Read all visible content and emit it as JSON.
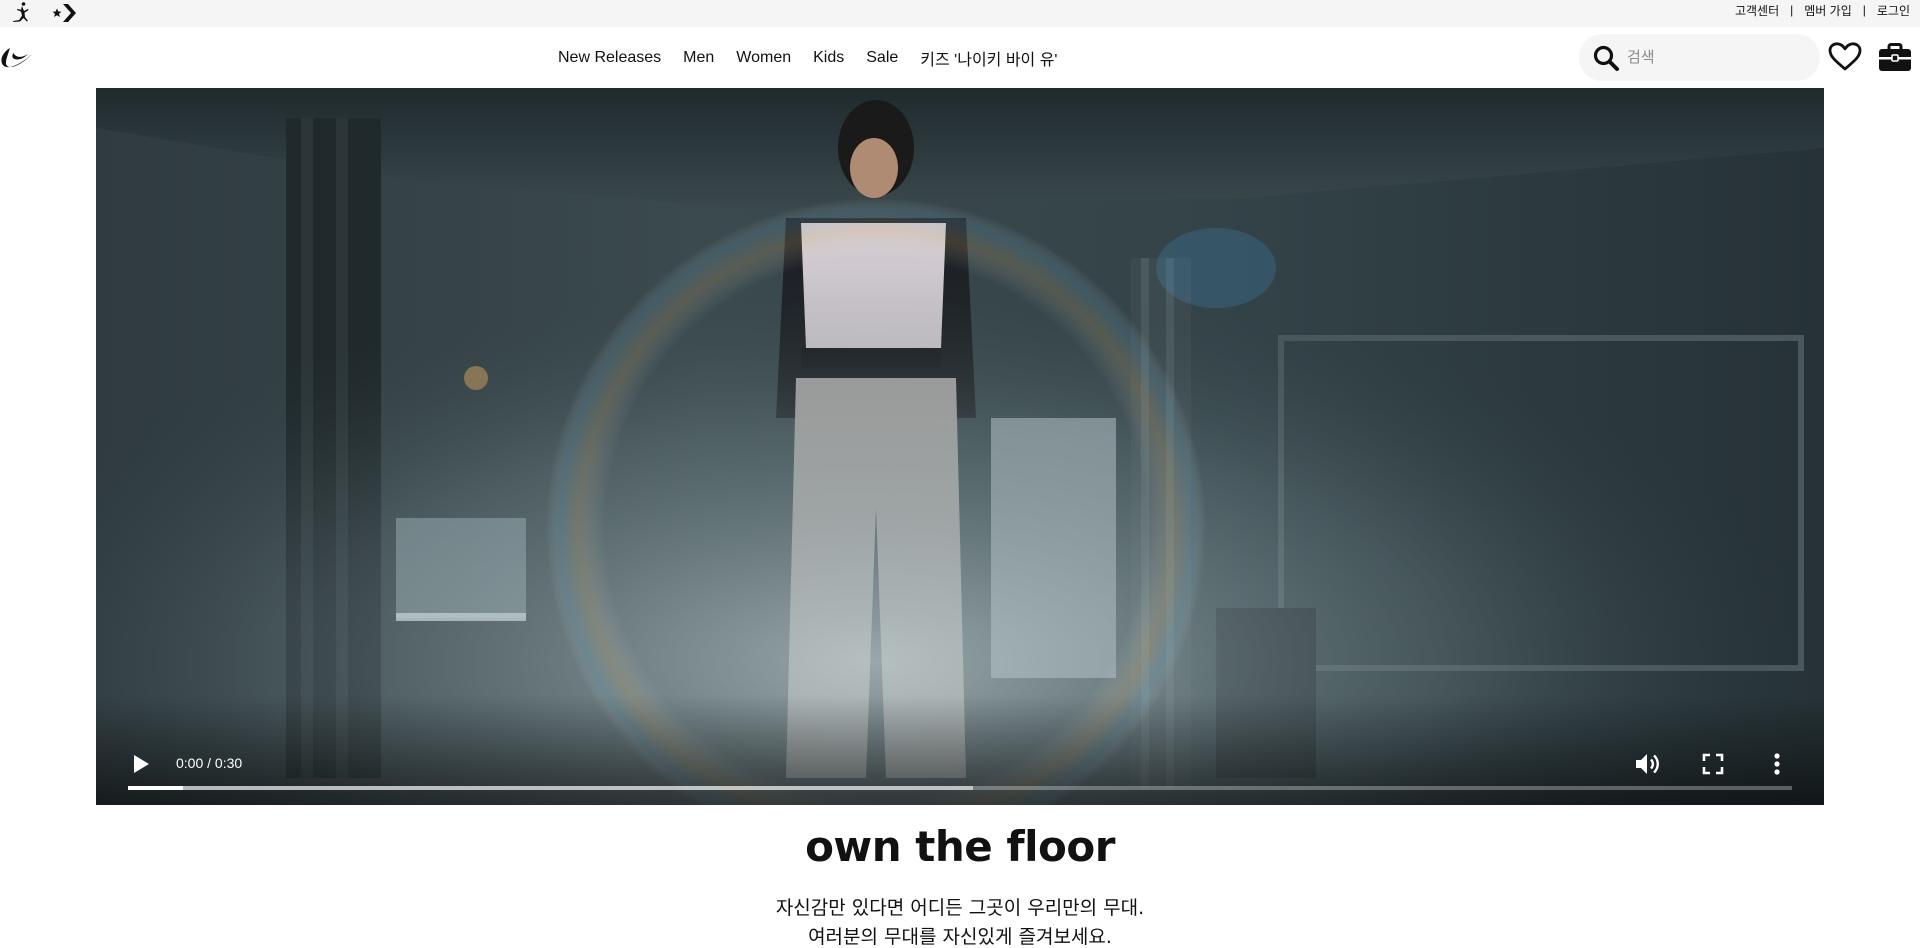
{
  "utility": {
    "links": [
      "고객센터",
      "멤버 가입",
      "로그인"
    ],
    "separator": "|"
  },
  "nav": {
    "items": [
      "New Releases",
      "Men",
      "Women",
      "Kids",
      "Sale",
      "키즈 '나이키 바이 유'"
    ]
  },
  "search": {
    "placeholder": "검색"
  },
  "video": {
    "current_time": "0:00",
    "duration": "0:30",
    "time_separator": " / ",
    "played_fraction": 0.033,
    "buffered_fraction": 0.508
  },
  "hero": {
    "headline": "own the floor",
    "sub_line_1": "자신감만 있다면 어디든 그곳이 우리만의 무대.",
    "sub_line_2": "여러분의 무대를 자신있게 즐겨보세요."
  },
  "colors": {
    "utility_bg": "#f5f5f5",
    "text": "#111111",
    "search_bg": "#f5f5f5"
  }
}
